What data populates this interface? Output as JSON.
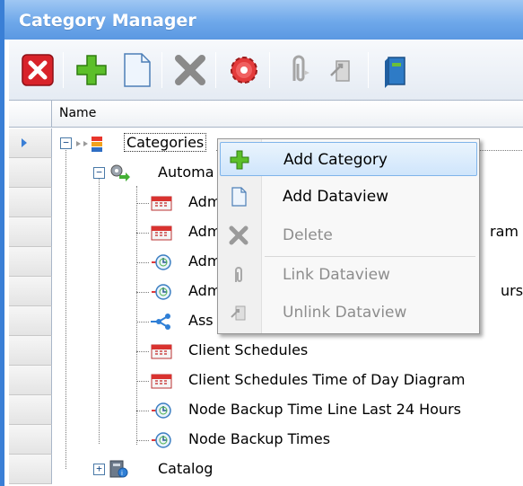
{
  "window": {
    "title": "Category Manager"
  },
  "toolbar": {
    "buttons": [
      {
        "name": "close-button",
        "icon": "red-x-icon",
        "enabled": true
      },
      {
        "name": "add-button",
        "icon": "green-plus-icon",
        "enabled": true
      },
      {
        "name": "new-document-button",
        "icon": "document-icon",
        "enabled": true
      },
      {
        "name": "delete-button",
        "icon": "gray-x-icon",
        "enabled": false
      },
      {
        "name": "settings-button",
        "icon": "red-gear-icon",
        "enabled": true
      },
      {
        "name": "link-button",
        "icon": "paperclip-icon",
        "enabled": false
      },
      {
        "name": "unlink-button",
        "icon": "unlink-icon",
        "enabled": false
      },
      {
        "name": "book-button",
        "icon": "book-icon",
        "enabled": true
      }
    ]
  },
  "grid": {
    "column_header": "Name",
    "rows": [
      {
        "label": "Categories",
        "icon": "categories-icon"
      },
      {
        "label": "Automa",
        "icon": "automation-icon"
      },
      {
        "label": "Adm",
        "icon": "calendar-icon"
      },
      {
        "label": "Adm",
        "icon": "calendar-icon",
        "tail": "ram"
      },
      {
        "label": "Adm",
        "icon": "clock-icon"
      },
      {
        "label": "Adm",
        "icon": "clock-icon",
        "tail": "urs"
      },
      {
        "label": "Ass",
        "icon": "share-icon"
      },
      {
        "label": "Client Schedules",
        "icon": "calendar-icon"
      },
      {
        "label": "Client Schedules Time of Day Diagram",
        "icon": "calendar-icon"
      },
      {
        "label": "Node Backup Time Line Last 24 Hours",
        "icon": "clock-icon"
      },
      {
        "label": "Node Backup Times",
        "icon": "clock-icon"
      },
      {
        "label": "Catalog",
        "icon": "catalog-icon"
      }
    ]
  },
  "context_menu": {
    "items": [
      {
        "label": "Add Category",
        "icon": "green-plus-icon",
        "enabled": true,
        "highlighted": true
      },
      {
        "label": "Add Dataview",
        "icon": "document-icon",
        "enabled": true
      },
      {
        "label": "Delete",
        "icon": "gray-x-icon",
        "enabled": false
      },
      {
        "label": "Link Dataview",
        "icon": "paperclip-icon",
        "enabled": false
      },
      {
        "label": "Unlink Dataview",
        "icon": "unlink-icon",
        "enabled": false
      }
    ]
  },
  "colors": {
    "title_bar": "#6ea8ea",
    "menu_highlight": "#cfe5fb",
    "disabled_text": "#8d8d8d"
  }
}
